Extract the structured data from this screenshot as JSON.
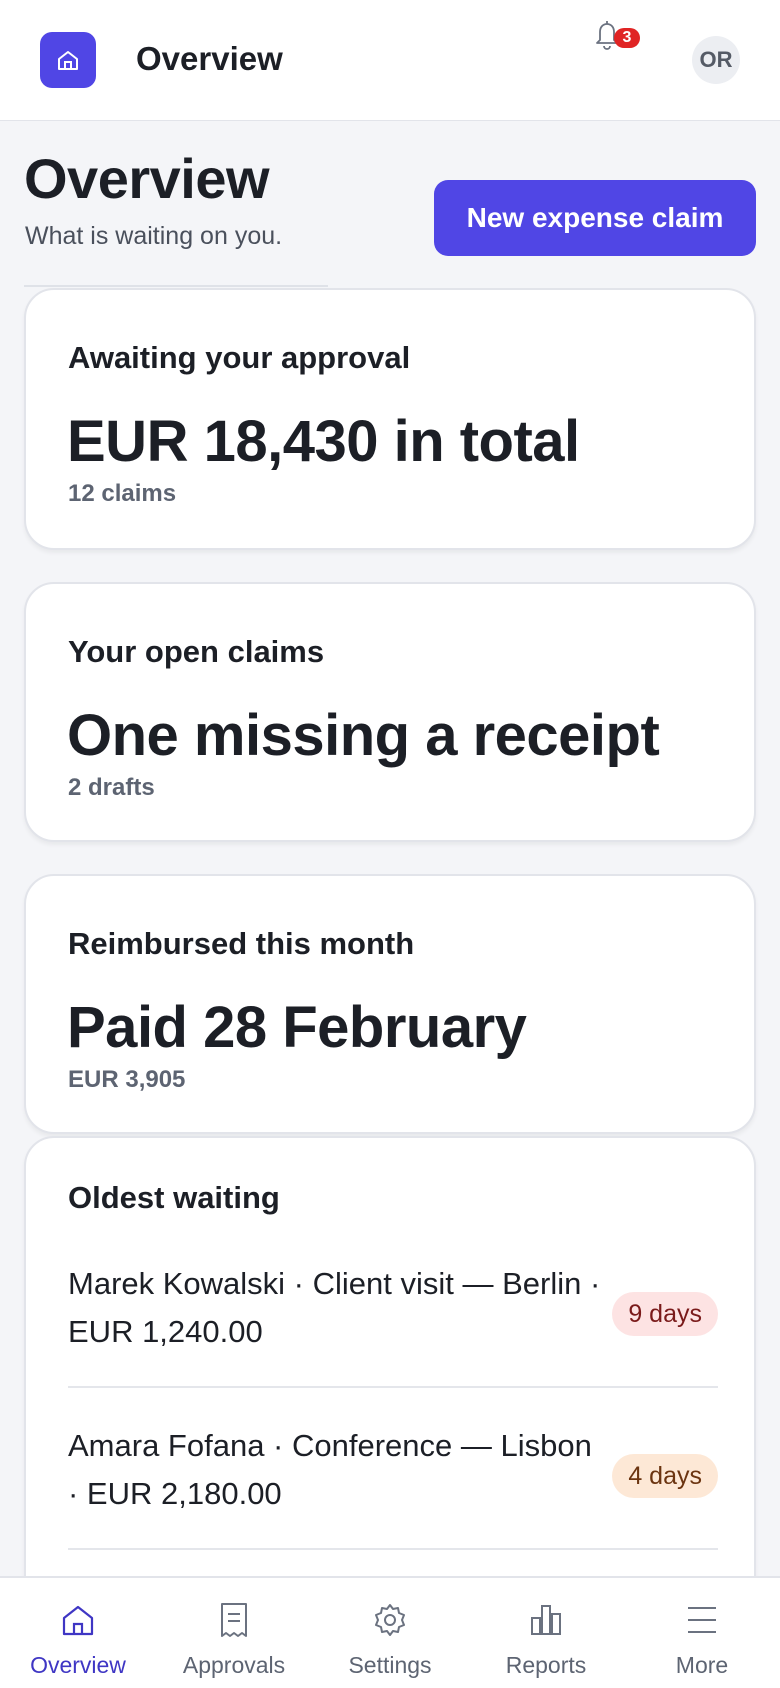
{
  "colors": {
    "accent": "#5046e5",
    "badge": "#e02424",
    "pill_red_bg": "#fde3e3",
    "pill_amber_bg": "#fde8d6"
  },
  "appbar": {
    "logo_icon": "home-icon",
    "title": "Overview",
    "notifications_icon": "bell-icon",
    "notifications_count": "3",
    "avatar_initials": "OR"
  },
  "header": {
    "title": "Overview",
    "subtitle": "What is waiting on you.",
    "primary_action": "New expense claim"
  },
  "cards": [
    {
      "label": "Awaiting your approval",
      "value": "EUR 18,430 in total",
      "meta": "12 claims"
    },
    {
      "label": "Your open claims",
      "value": "One missing a receipt",
      "meta": "2 drafts"
    },
    {
      "label": "Reimbursed this month",
      "value": "Paid 28 February",
      "meta": "EUR 3,905"
    }
  ],
  "oldest_waiting": {
    "label": "Oldest waiting",
    "items": [
      {
        "text": "Marek Kowalski · Client visit — Berlin · EUR 1,240.00",
        "age": "9 days",
        "tone": "red"
      },
      {
        "text": "Amara Fofana · Conference — Lisbon · EUR 2,180.00",
        "age": "4 days",
        "tone": "amber"
      }
    ]
  },
  "bottom_nav": {
    "items": [
      {
        "label": "Overview",
        "icon": "home-icon",
        "active": true
      },
      {
        "label": "Approvals",
        "icon": "receipt-icon",
        "active": false
      },
      {
        "label": "Settings",
        "icon": "gear-icon",
        "active": false
      },
      {
        "label": "Reports",
        "icon": "bar-chart-icon",
        "active": false
      },
      {
        "label": "More",
        "icon": "menu-icon",
        "active": false
      }
    ]
  }
}
